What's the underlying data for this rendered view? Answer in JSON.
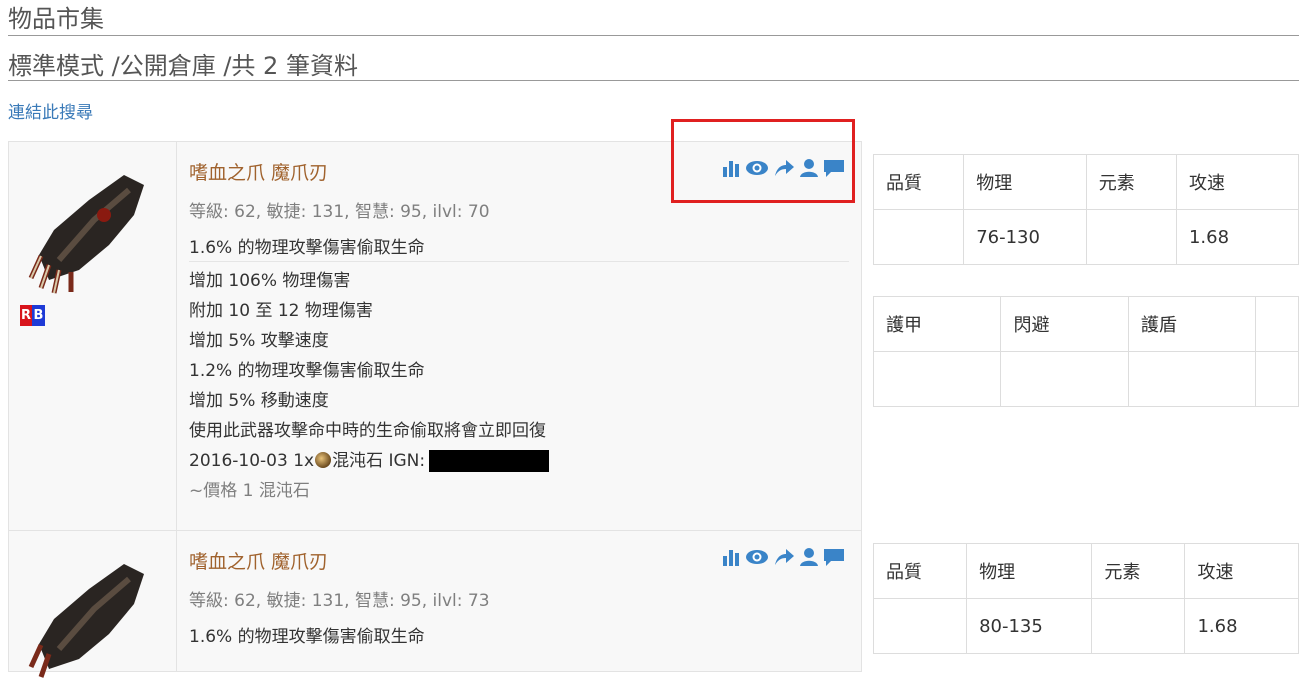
{
  "page": {
    "title": "物品市集",
    "subtitle": "標準模式 /公開倉庫 /共 2 筆資料",
    "search_link": "連結此搜尋"
  },
  "colors": {
    "link": "#3a7ab8",
    "item_name": "#a0622d",
    "icon": "#3a84c8",
    "highlight": "#e02020"
  },
  "icons": [
    "bar-chart-icon",
    "eye-icon",
    "share-arrow-icon",
    "user-icon",
    "comment-icon"
  ],
  "items": [
    {
      "badge": [
        "R",
        "B"
      ],
      "name": "嗜血之爪 魔爪刃",
      "requirements": "等級: 62, 敏捷: 131, 智慧: 95, ilvl: 70",
      "implicit": "1.6% 的物理攻擊傷害偷取生命",
      "mods": [
        "增加 106% 物理傷害",
        "附加 10 至 12 物理傷害",
        "增加 5% 攻擊速度",
        "1.2% 的物理攻擊傷害偷取生命",
        "增加 5% 移動速度",
        "使用此武器攻擊命中時的生命偷取將會立即回復"
      ],
      "listing_prefix": "2016-10-03 1x",
      "listing_currency": "混沌石 IGN:",
      "price": "~價格 1 混沌石",
      "weapon_table": {
        "headers": [
          "品質",
          "物理",
          "元素",
          "攻速"
        ],
        "values": [
          "",
          "76-130",
          "",
          "1.68"
        ]
      },
      "armour_table": {
        "headers": [
          "護甲",
          "閃避",
          "護盾"
        ],
        "values": [
          "",
          "",
          ""
        ]
      }
    },
    {
      "name": "嗜血之爪 魔爪刃",
      "requirements": "等級: 62, 敏捷: 131, 智慧: 95, ilvl: 73",
      "implicit": "1.6% 的物理攻擊傷害偷取生命",
      "weapon_table": {
        "headers": [
          "品質",
          "物理",
          "元素",
          "攻速"
        ],
        "values": [
          "",
          "80-135",
          "",
          "1.68"
        ]
      }
    }
  ]
}
